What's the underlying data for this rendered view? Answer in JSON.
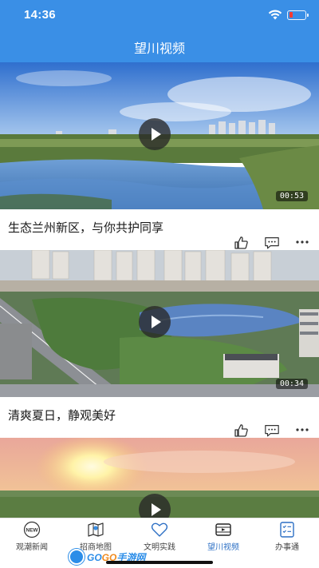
{
  "status_bar": {
    "time": "14:36",
    "battery_color": "#ff3b30",
    "battery_level": 0.25
  },
  "header": {
    "title": "望川视频",
    "background": "#3a8fe6"
  },
  "videos": [
    {
      "title": "生态兰州新区，与你共护同享",
      "duration": "00:53",
      "scene": "wetland-lake"
    },
    {
      "title": "清爽夏日，静观美好",
      "duration": "00:34",
      "scene": "city-park-aerial"
    },
    {
      "title": "",
      "duration": "",
      "scene": "sunset-field"
    }
  ],
  "actions": {
    "like_icon": "thumbs-up-icon",
    "comment_icon": "comment-icon",
    "more_icon": "more-icon"
  },
  "tab_bar": {
    "items": [
      {
        "label": "观潮新闻",
        "icon": "new-badge-icon",
        "active": false
      },
      {
        "label": "招商地图",
        "icon": "map-icon",
        "active": false
      },
      {
        "label": "文明实践",
        "icon": "heart-icon",
        "active": false
      },
      {
        "label": "望川视频",
        "icon": "video-icon",
        "active": true
      },
      {
        "label": "办事通",
        "icon": "checklist-icon",
        "active": false
      }
    ],
    "active_color": "#2c6fc4"
  },
  "watermark": {
    "part1": "GO",
    "part2": "GO",
    "part3": "手游网"
  }
}
